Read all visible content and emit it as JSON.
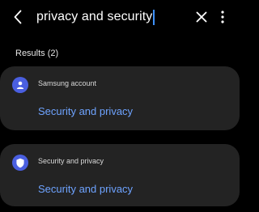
{
  "search": {
    "query": "privacy and security"
  },
  "icons": {
    "back": "back-arrow-icon",
    "clear": "close-icon",
    "more": "more-vertical-icon",
    "account": "person-icon",
    "security": "shield-icon"
  },
  "results": {
    "header": "Results (2)",
    "items": [
      {
        "source": "Samsung account",
        "title": "Security and privacy",
        "icon": "person-icon"
      },
      {
        "source": "Security and privacy",
        "title": "Security and privacy",
        "icon": "shield-icon"
      }
    ]
  },
  "colors": {
    "background": "#000000",
    "card": "#232323",
    "accent_link": "#6ea3ff",
    "icon_badge": "#4a5fe0",
    "cursor": "#3e91ff"
  }
}
